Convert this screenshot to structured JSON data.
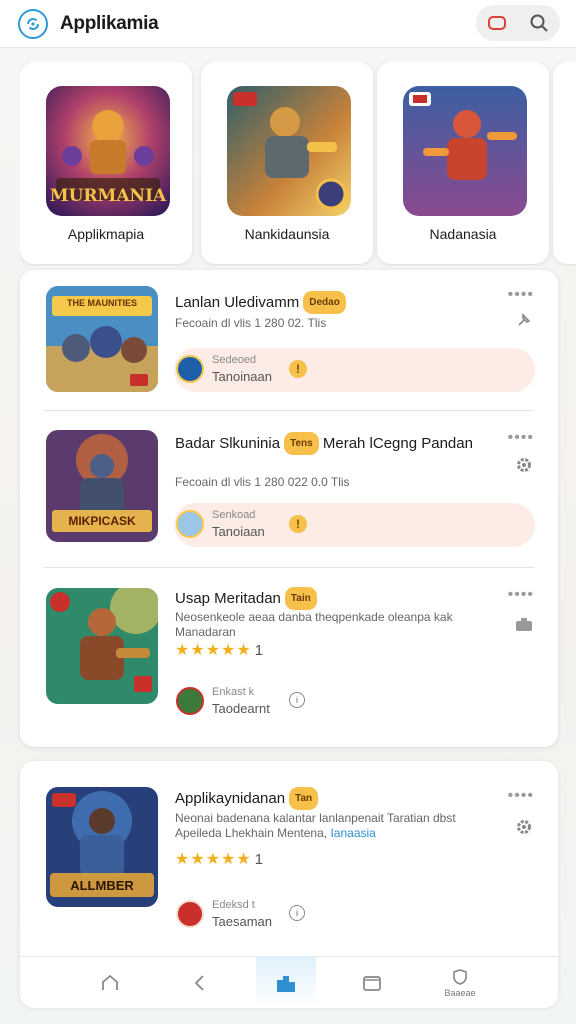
{
  "header": {
    "title": "Applikamia"
  },
  "featured": [
    {
      "name": "Applikmapia",
      "art_text": "MURMANIA"
    },
    {
      "name": "Nankidaunsia",
      "art_text": ""
    },
    {
      "name": "Nadanasia",
      "art_text": ""
    }
  ],
  "games": [
    {
      "title": "Lanlan Uledivamm",
      "tag": "Dedao",
      "meta": "Fecoain dl vlis 1 280 02. Tlis",
      "install_label": "Sedeoed",
      "install_sub": "Tanoinaan",
      "badge": "!",
      "thumb_text": "THE MAUNITIES"
    },
    {
      "title": "Badar Slkuninia",
      "tag": "Tens",
      "title_suffix": "Merah lCegng Pandan",
      "meta": "Fecoain dl vlis 1 280 022 0.0 Tlis",
      "install_label": "Senkoad",
      "install_sub": "Tanoiaan",
      "badge": "!",
      "thumb_text": "MIKPICASK"
    },
    {
      "title": "Usap Meritadan",
      "tag": "Tain",
      "meta": "Neosenkeole aeaa danba theqpenkade oleanpa kak Manadaran",
      "stars": "★★★★★",
      "rating": "1",
      "install_label": "Enkast k",
      "install_sub": "Taodearnt",
      "thumb_text": ""
    },
    {
      "title": "Applikaynidanan",
      "tag": "Tan",
      "meta": "Neonai badenana kalantar lanlanpenait Taratian dbst Apeileda Lhekhain Mentena,",
      "meta_link": "Ianaasia",
      "stars": "★★★★★",
      "rating": "1",
      "install_label": "Edeksd t",
      "install_sub": "Taesaman",
      "thumb_text": "ALLMBER"
    }
  ],
  "nav": {
    "items": [
      "home",
      "back",
      "apps",
      "folder",
      "profile"
    ],
    "profile_label": "Baaeae"
  },
  "colors": {
    "accent": "#2f9bd6",
    "tag": "#f6c04a",
    "pill": "#fdece6"
  }
}
